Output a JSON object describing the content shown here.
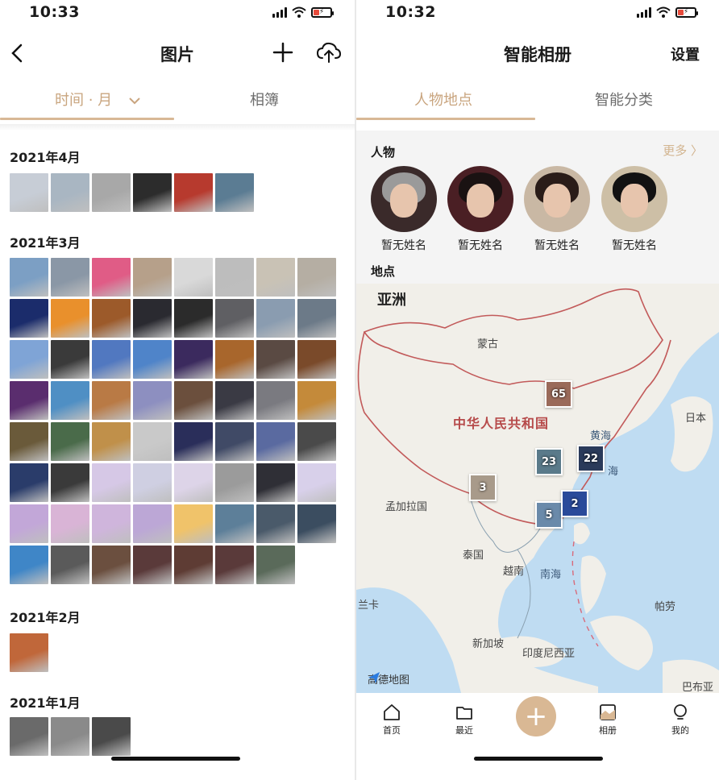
{
  "left": {
    "status": {
      "time": "10:33"
    },
    "nav": {
      "title": "图片"
    },
    "tabs": {
      "time_label": "时间 · 月",
      "album_label": "相簿"
    },
    "sections": [
      {
        "title": "2021年4月",
        "thumb_colors": [
          "#c7cdd6",
          "#a9b6c2",
          "#a8a8a8",
          "#2c2c2c",
          "#b73a2e",
          "#5b7c93"
        ]
      },
      {
        "title": "2021年3月",
        "thumb_colors": [
          "#7c9fc4",
          "#8a97a6",
          "#e05c86",
          "#b6a08a",
          "#d9d9d9",
          "#bdbdbd",
          "#c9c2b5",
          "#b5aea3",
          "#1b2c6b",
          "#e9902c",
          "#9c5a2a",
          "#2a2a30",
          "#2b2b2b",
          "#5f5f63",
          "#8a9cb0",
          "#6c7a88",
          "#7fa4d6",
          "#3a3a3a",
          "#5178c0",
          "#4f84c9",
          "#3b2a5e",
          "#a8662c",
          "#5a4a43",
          "#7a4a2a",
          "#5a2d6e",
          "#4f8fc4",
          "#b97a45",
          "#8d8fc0",
          "#6b4f3d",
          "#3a3a44",
          "#7a7a80",
          "#c48a3a",
          "#6a5a3a",
          "#4a6b4a",
          "#c0904a",
          "#c9c9c9",
          "#2a2e5a",
          "#404a66",
          "#5a6aa0",
          "#4a4a4a",
          "#2a3c6a",
          "#3a3a3a",
          "#d6c8e6",
          "#cfcfe2",
          "#ddd4e8",
          "#9b9b9b",
          "#2f2f36",
          "#d8d0ea",
          "#c2a7d8",
          "#d9b4d6",
          "#cfb5dc",
          "#bca7d6",
          "#f0c36a",
          "#5d7f99",
          "#4a5a6a",
          "#3b4d60",
          "#3f86c7",
          "#5a5a5a",
          "#6b4f3f",
          "#5a3a3a",
          "#5e3c34",
          "#5a3a3a",
          "#5a6a5a"
        ]
      },
      {
        "title": "2021年2月",
        "thumb_colors": [
          "#c0673a"
        ]
      },
      {
        "title": "2021年1月",
        "thumb_colors": [
          "#6a6a6a",
          "#8a8a8a",
          "#4a4a4a"
        ]
      }
    ]
  },
  "right": {
    "status": {
      "time": "10:32"
    },
    "nav": {
      "title": "智能相册",
      "settings_label": "设置"
    },
    "tabs": {
      "people_places_label": "人物地点",
      "smart_label": "智能分类"
    },
    "people": {
      "title": "人物",
      "more_label": "更多 〉",
      "items": [
        {
          "name": "暂无姓名",
          "bg": "#3a2a2a",
          "hair": "#9a9a9a"
        },
        {
          "name": "暂无姓名",
          "bg": "#4a1f24",
          "hair": "#1a1212"
        },
        {
          "name": "暂无姓名",
          "bg": "#c9b8a4",
          "hair": "#2a1c18"
        },
        {
          "name": "暂无姓名",
          "bg": "#cdbfa6",
          "hair": "#121212"
        }
      ]
    },
    "places": {
      "title": "地点",
      "labels": {
        "continent": "亚洲",
        "mongolia": "蒙古",
        "china": "中华人民共和国",
        "yellow_sea": "黄海",
        "east_sea": "海",
        "japan": "日本",
        "bangladesh": "孟加拉国",
        "thailand": "泰国",
        "vietnam": "越南",
        "south_sea": "南海",
        "sri_lanka": "兰卡",
        "palau": "帕劳",
        "singapore": "新加坡",
        "indonesia": "印度尼西亚",
        "papua": "巴布亚"
      },
      "clusters": [
        {
          "count": "65",
          "color": "#9a6a5a"
        },
        {
          "count": "23",
          "color": "#5a7a8a"
        },
        {
          "count": "22",
          "color": "#2a3a5a"
        },
        {
          "count": "3",
          "color": "#a89a8a"
        },
        {
          "count": "5",
          "color": "#6a8aaa"
        },
        {
          "count": "2",
          "color": "#2a4a9a"
        }
      ],
      "provider": "高德地图"
    },
    "tabbar": {
      "home": "首页",
      "recent": "最近",
      "album": "相册",
      "mine": "我的"
    }
  }
}
